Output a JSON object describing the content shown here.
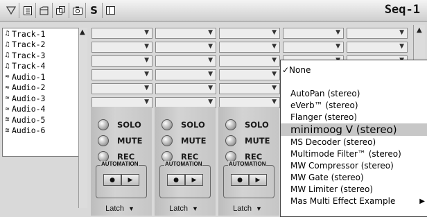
{
  "window": {
    "title": "Seq-1"
  },
  "toolbar": {
    "icons": [
      "triangle-dropdown-icon",
      "document-icon",
      "window-icon",
      "overlap-windows-icon",
      "camera-icon",
      "s-icon",
      "panel-icon"
    ],
    "s_label": "S"
  },
  "tracks": [
    {
      "name": "Track-1",
      "type": "midi"
    },
    {
      "name": "Track-2",
      "type": "midi"
    },
    {
      "name": "Track-3",
      "type": "midi"
    },
    {
      "name": "Track-4",
      "type": "midi"
    },
    {
      "name": "Audio-1",
      "type": "mono-audio"
    },
    {
      "name": "Audio-2",
      "type": "mono-audio"
    },
    {
      "name": "Audio-3",
      "type": "mono-audio"
    },
    {
      "name": "Audio-4",
      "type": "mono-audio"
    },
    {
      "name": "Audio-5",
      "type": "stereo-audio"
    },
    {
      "name": "Audio-6",
      "type": "stereo-audio"
    }
  ],
  "channels": [
    {
      "solo": "SOLO",
      "mute": "MUTE",
      "rec": "REC",
      "automation": "AUTOMATION",
      "mode": "Latch"
    },
    {
      "solo": "SOLO",
      "mute": "MUTE",
      "rec": "REC",
      "automation": "AUTOMATION",
      "mode": "Latch"
    },
    {
      "solo": "SOLO",
      "mute": "MUTE",
      "rec": "REC",
      "automation": "AUTOMATION",
      "mode": "Latch"
    }
  ],
  "insert_menu": {
    "checked": "None",
    "items": [
      "AutoPan (stereo)",
      "eVerb™ (stereo)",
      "Flanger (stereo)",
      "minimoog V  (stereo)",
      "MS Decoder (stereo)",
      "Multimode Filter™ (stereo)",
      "MW Compressor (stereo)",
      "MW Gate (stereo)",
      "MW Limiter (stereo)",
      "Mas Multi Effect Example"
    ],
    "highlighted": "minimoog V  (stereo)",
    "submenu": "Mas Multi Effect Example"
  },
  "colors": {
    "background": "#d9d9d9",
    "menu_highlight": "#c7c7c7"
  }
}
